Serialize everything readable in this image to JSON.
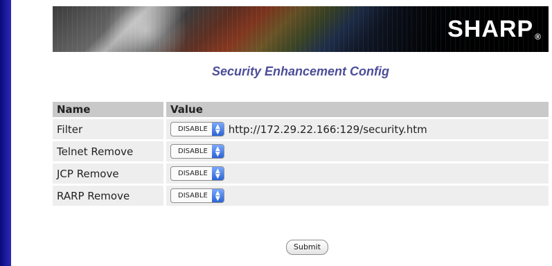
{
  "brand": {
    "logo": "SHARP",
    "registered": "®"
  },
  "page": {
    "title": "Security Enhancement Config"
  },
  "table": {
    "headers": {
      "name": "Name",
      "value": "Value"
    },
    "rows": [
      {
        "name": "Filter",
        "select": "DISABLE",
        "extra": "http://172.29.22.166:129/security.htm"
      },
      {
        "name": "Telnet Remove",
        "select": "DISABLE",
        "extra": ""
      },
      {
        "name": "JCP Remove",
        "select": "DISABLE",
        "extra": ""
      },
      {
        "name": "RARP Remove",
        "select": "DISABLE",
        "extra": ""
      }
    ]
  },
  "submit_label": "Submit",
  "colors": {
    "background": "#1414c8",
    "title": "#4d4d99",
    "header_row": "#c9c9c9",
    "row": "#eeeeee"
  }
}
